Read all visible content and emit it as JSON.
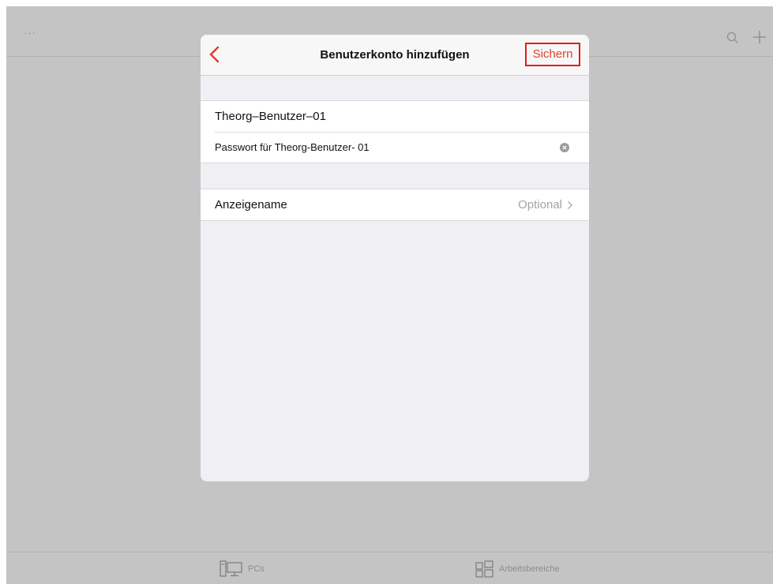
{
  "background": {
    "more_label": "···",
    "tabs": [
      {
        "label": "PCs",
        "icon": "pc-monitor-icon"
      },
      {
        "label": "Arbeitsbereiche",
        "icon": "workspaces-grid-icon"
      }
    ]
  },
  "modal": {
    "title": "Benutzerkonto hinzufügen",
    "save_label": "Sichern",
    "username_value": "Theorg–Benutzer–01",
    "password_value": "Passwort für Theorg-Benutzer- 01",
    "display_name_label": "Anzeigename",
    "display_name_value": "Optional",
    "accent_color": "#e0402a"
  }
}
